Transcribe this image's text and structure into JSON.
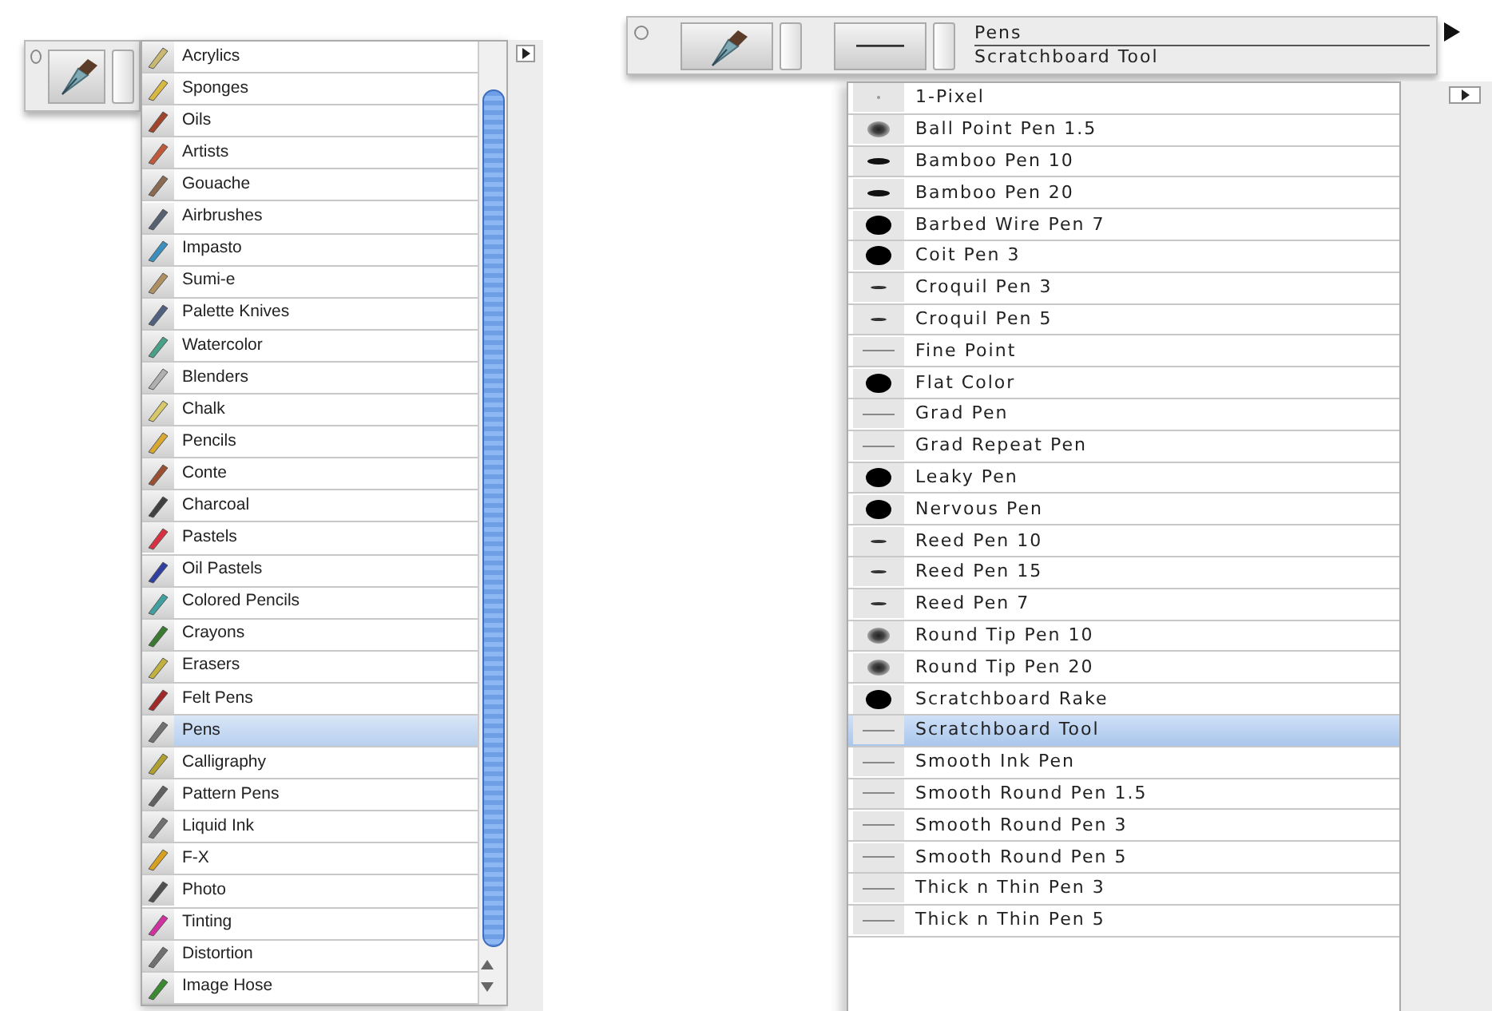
{
  "brush_selector": {
    "categories": [
      {
        "label": "Acrylics",
        "selected": false
      },
      {
        "label": "Sponges",
        "selected": false
      },
      {
        "label": "Oils",
        "selected": false
      },
      {
        "label": "Artists",
        "selected": false
      },
      {
        "label": "Gouache",
        "selected": false
      },
      {
        "label": "Airbrushes",
        "selected": false
      },
      {
        "label": "Impasto",
        "selected": false
      },
      {
        "label": "Sumi-e",
        "selected": false
      },
      {
        "label": "Palette Knives",
        "selected": false
      },
      {
        "label": "Watercolor",
        "selected": false
      },
      {
        "label": "Blenders",
        "selected": false
      },
      {
        "label": "Chalk",
        "selected": false
      },
      {
        "label": "Pencils",
        "selected": false
      },
      {
        "label": "Conte",
        "selected": false
      },
      {
        "label": "Charcoal",
        "selected": false
      },
      {
        "label": "Pastels",
        "selected": false
      },
      {
        "label": "Oil Pastels",
        "selected": false
      },
      {
        "label": "Colored Pencils",
        "selected": false
      },
      {
        "label": "Crayons",
        "selected": false
      },
      {
        "label": "Erasers",
        "selected": false
      },
      {
        "label": "Felt Pens",
        "selected": false
      },
      {
        "label": "Pens",
        "selected": true
      },
      {
        "label": "Calligraphy",
        "selected": false
      },
      {
        "label": "Pattern Pens",
        "selected": false
      },
      {
        "label": "Liquid Ink",
        "selected": false
      },
      {
        "label": "F-X",
        "selected": false
      },
      {
        "label": "Photo",
        "selected": false
      },
      {
        "label": "Tinting",
        "selected": false
      },
      {
        "label": "Distortion",
        "selected": false
      },
      {
        "label": "Image Hose",
        "selected": false
      }
    ]
  },
  "variant_selector": {
    "category": "Pens",
    "variant": "Scratchboard Tool",
    "variants": [
      {
        "label": "1-Pixel",
        "kind": "pixel",
        "selected": false
      },
      {
        "label": "Ball Point Pen 1.5",
        "kind": "soft",
        "selected": false
      },
      {
        "label": "Bamboo Pen 10",
        "kind": "dash",
        "selected": false
      },
      {
        "label": "Bamboo Pen 20",
        "kind": "dash",
        "selected": false
      },
      {
        "label": "Barbed Wire Pen 7",
        "kind": "dot",
        "selected": false
      },
      {
        "label": "Coit Pen 3",
        "kind": "dot",
        "selected": false
      },
      {
        "label": "Croquil Pen 3",
        "kind": "tick",
        "selected": false
      },
      {
        "label": "Croquil Pen 5",
        "kind": "tick",
        "selected": false
      },
      {
        "label": "Fine Point",
        "kind": "line",
        "selected": false
      },
      {
        "label": "Flat Color",
        "kind": "dot",
        "selected": false
      },
      {
        "label": "Grad Pen",
        "kind": "line",
        "selected": false
      },
      {
        "label": "Grad Repeat Pen",
        "kind": "line",
        "selected": false
      },
      {
        "label": "Leaky Pen",
        "kind": "dot",
        "selected": false
      },
      {
        "label": "Nervous Pen",
        "kind": "dot",
        "selected": false
      },
      {
        "label": "Reed Pen 10",
        "kind": "tick",
        "selected": false
      },
      {
        "label": "Reed Pen 15",
        "kind": "tick",
        "selected": false
      },
      {
        "label": "Reed Pen 7",
        "kind": "tick",
        "selected": false
      },
      {
        "label": "Round Tip Pen 10",
        "kind": "soft",
        "selected": false
      },
      {
        "label": "Round Tip Pen 20",
        "kind": "soft",
        "selected": false
      },
      {
        "label": "Scratchboard Rake",
        "kind": "dot",
        "selected": false
      },
      {
        "label": "Scratchboard Tool",
        "kind": "line",
        "selected": true
      },
      {
        "label": "Smooth Ink Pen",
        "kind": "line",
        "selected": false
      },
      {
        "label": "Smooth Round Pen 1.5",
        "kind": "line",
        "selected": false
      },
      {
        "label": "Smooth Round Pen 3",
        "kind": "line",
        "selected": false
      },
      {
        "label": "Smooth Round Pen 5",
        "kind": "line",
        "selected": false
      },
      {
        "label": "Thick n Thin Pen 3",
        "kind": "line",
        "selected": false
      },
      {
        "label": "Thick n Thin Pen 5",
        "kind": "line",
        "selected": false
      }
    ]
  }
}
